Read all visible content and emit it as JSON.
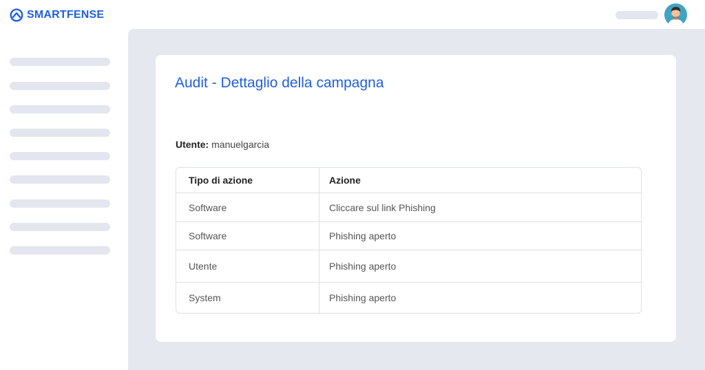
{
  "brand": {
    "name": "SMARTFENSE",
    "color": "#1f5fe0",
    "icon": "smartfense-logo-icon"
  },
  "header": {
    "avatar_icon": "user-avatar-icon"
  },
  "sidebar": {
    "item_count": 9
  },
  "page": {
    "title": "Audit - Dettaglio della campagna",
    "user_label": "Utente:",
    "user_value": "manuelgarcia"
  },
  "table": {
    "headers": [
      "Tipo di azione",
      "Azione"
    ],
    "rows": [
      [
        "Software",
        "Cliccare sul link Phishing"
      ],
      [
        "Software",
        "Phishing aperto"
      ],
      [
        "Utente",
        "Phishing aperto"
      ],
      [
        "System",
        "Phishing aperto"
      ]
    ]
  }
}
